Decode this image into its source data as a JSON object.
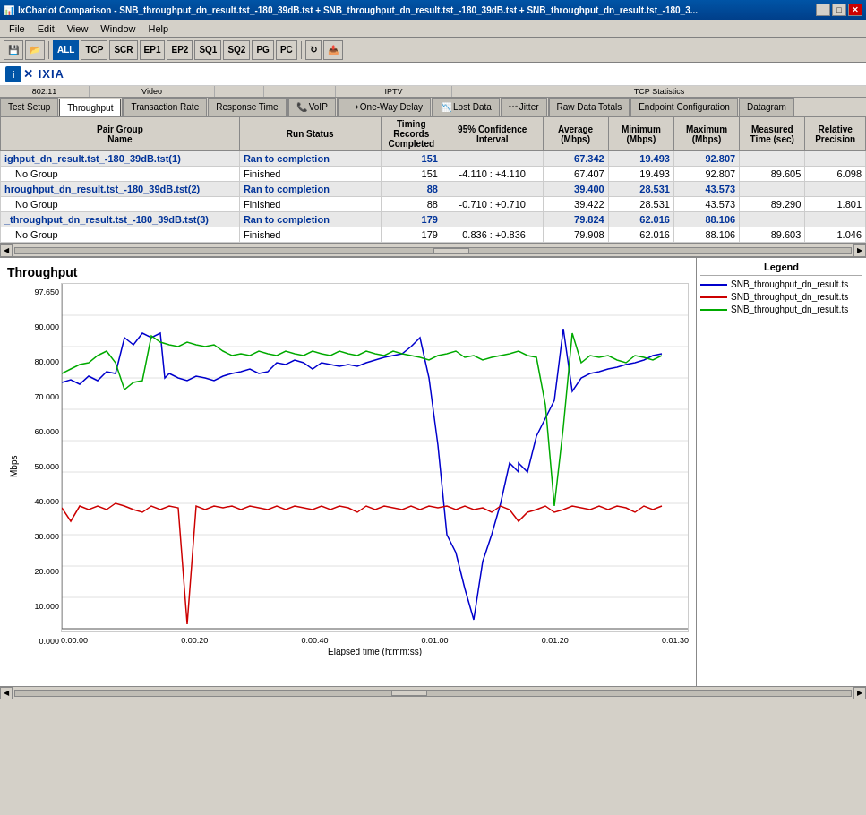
{
  "window": {
    "title": "IxChariot Comparison - SNB_throughput_dn_result.tst_-180_39dB.tst + SNB_throughput_dn_result.tst_-180_39dB.tst + SNB_throughput_dn_result.tst_-180_3...",
    "title_short": "IxChariot Comparison"
  },
  "menu": {
    "items": [
      "File",
      "Edit",
      "View",
      "Window",
      "Help"
    ]
  },
  "toolbar": {
    "buttons": [
      "ALL",
      "TCP",
      "SCR",
      "EP1",
      "EP2",
      "SQ1",
      "SQ2",
      "PG",
      "PC"
    ]
  },
  "logo": {
    "prefix": "X",
    "brand": "IXIA"
  },
  "tabs": {
    "row1": {
      "groups": [
        {
          "label": "802.11",
          "tabs": [
            "Test Setup",
            "Throughput"
          ]
        },
        {
          "label": "Video",
          "tabs": [
            "Transaction Rate",
            "Response Time"
          ]
        },
        {
          "label": "",
          "tabs": [
            "VoIP"
          ]
        },
        {
          "label": "",
          "tabs": [
            "One-Way Delay"
          ]
        },
        {
          "label": "IPTV",
          "tabs": [
            "Lost Data"
          ]
        },
        {
          "label": "",
          "tabs": [
            "Jitter"
          ]
        },
        {
          "label": "TCP Statistics",
          "tabs": [
            "Raw Data Totals",
            "Endpoint Configuration",
            "Datagram"
          ]
        }
      ]
    }
  },
  "table": {
    "headers": [
      "Pair Group Name",
      "Run Status",
      "Timing Records Completed",
      "95% Confidence Interval",
      "Average (Mbps)",
      "Minimum (Mbps)",
      "Maximum (Mbps)",
      "Measured Time (sec)",
      "Relative Precision"
    ],
    "rows": [
      {
        "type": "header",
        "name": "ighput_dn_result.tst_-180_39dB.tst(1)",
        "status": "Ran to completion",
        "records": "151",
        "confidence": "",
        "average": "67.342",
        "minimum": "19.493",
        "maximum": "92.807",
        "measured": "",
        "precision": ""
      },
      {
        "type": "sub",
        "name": "No Group",
        "status": "Finished",
        "records": "151",
        "confidence": "-4.110 : +4.110",
        "average": "67.407",
        "minimum": "19.493",
        "maximum": "92.807",
        "measured": "89.605",
        "precision": "6.098"
      },
      {
        "type": "header",
        "name": "hroughput_dn_result.tst_-180_39dB.tst(2)",
        "status": "Ran to completion",
        "records": "88",
        "confidence": "",
        "average": "39.400",
        "minimum": "28.531",
        "maximum": "43.573",
        "measured": "",
        "precision": ""
      },
      {
        "type": "sub",
        "name": "No Group",
        "status": "Finished",
        "records": "88",
        "confidence": "-0.710 : +0.710",
        "average": "39.422",
        "minimum": "28.531",
        "maximum": "43.573",
        "measured": "89.290",
        "precision": "1.801"
      },
      {
        "type": "header",
        "name": "_throughput_dn_result.tst_-180_39dB.tst(3)",
        "status": "Ran to completion",
        "records": "179",
        "confidence": "",
        "average": "79.824",
        "minimum": "62.016",
        "maximum": "88.106",
        "measured": "",
        "precision": ""
      },
      {
        "type": "sub",
        "name": "No Group",
        "status": "Finished",
        "records": "179",
        "confidence": "-0.836 : +0.836",
        "average": "79.908",
        "minimum": "62.016",
        "maximum": "88.106",
        "measured": "89.603",
        "precision": "1.046"
      }
    ]
  },
  "chart": {
    "title": "Throughput",
    "y_label": "Mbps",
    "x_label": "Elapsed time (h:mm:ss)",
    "y_ticks": [
      "97.650",
      "90.000",
      "80.000",
      "70.000",
      "60.000",
      "50.000",
      "40.000",
      "30.000",
      "20.000",
      "10.000",
      "0.000"
    ],
    "x_ticks": [
      "0:00:00",
      "0:00:20",
      "0:00:40",
      "0:01:00",
      "0:01:20",
      "0:01:30"
    ]
  },
  "legend": {
    "title": "Legend",
    "items": [
      {
        "label": "SNB_throughput_dn_result.ts",
        "color": "#0000cc"
      },
      {
        "label": "SNB_throughput_dn_result.ts",
        "color": "#cc0000"
      },
      {
        "label": "SNB_throughput_dn_result.ts",
        "color": "#00aa00"
      }
    ]
  }
}
